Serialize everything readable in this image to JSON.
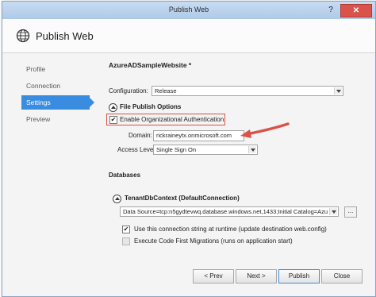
{
  "window": {
    "title": "Publish Web",
    "help_glyph": "?",
    "close_glyph": "✕"
  },
  "header": {
    "title": "Publish Web"
  },
  "nav": {
    "items": [
      {
        "label": "Profile"
      },
      {
        "label": "Connection"
      },
      {
        "label": "Settings"
      },
      {
        "label": "Preview"
      }
    ],
    "active": "Settings"
  },
  "settings": {
    "profile_name": "AzureADSampleWebsite *",
    "configuration_label": "Configuration:",
    "configuration_value": "Release",
    "file_publish_options": "File Publish Options",
    "enable_org_auth": "Enable Organizational Authentication",
    "enable_org_auth_checked": true,
    "domain_label": "Domain:",
    "domain_value": "rickraineytx.onmicrosoft.com",
    "access_level_label": "Access Level:",
    "access_level_value": "Single Sign On",
    "databases_heading": "Databases",
    "db_context_name": "TenantDbContext (DefaultConnection)",
    "connection_string": "Data Source=tcp:n5gydtevwq.database.windows.net,1433;Initial Catalog=Azu",
    "ellipsis": "...",
    "use_conn_string": "Use this connection string at runtime (update destination web.config)",
    "use_conn_string_checked": true,
    "code_first": "Execute Code First Migrations (runs on application start)",
    "code_first_checked": false
  },
  "buttons": {
    "prev": "< Prev",
    "next": "Next >",
    "publish": "Publish",
    "close": "Close"
  },
  "colors": {
    "accent": "#3a8ce0",
    "highlight": "#d9534a"
  }
}
